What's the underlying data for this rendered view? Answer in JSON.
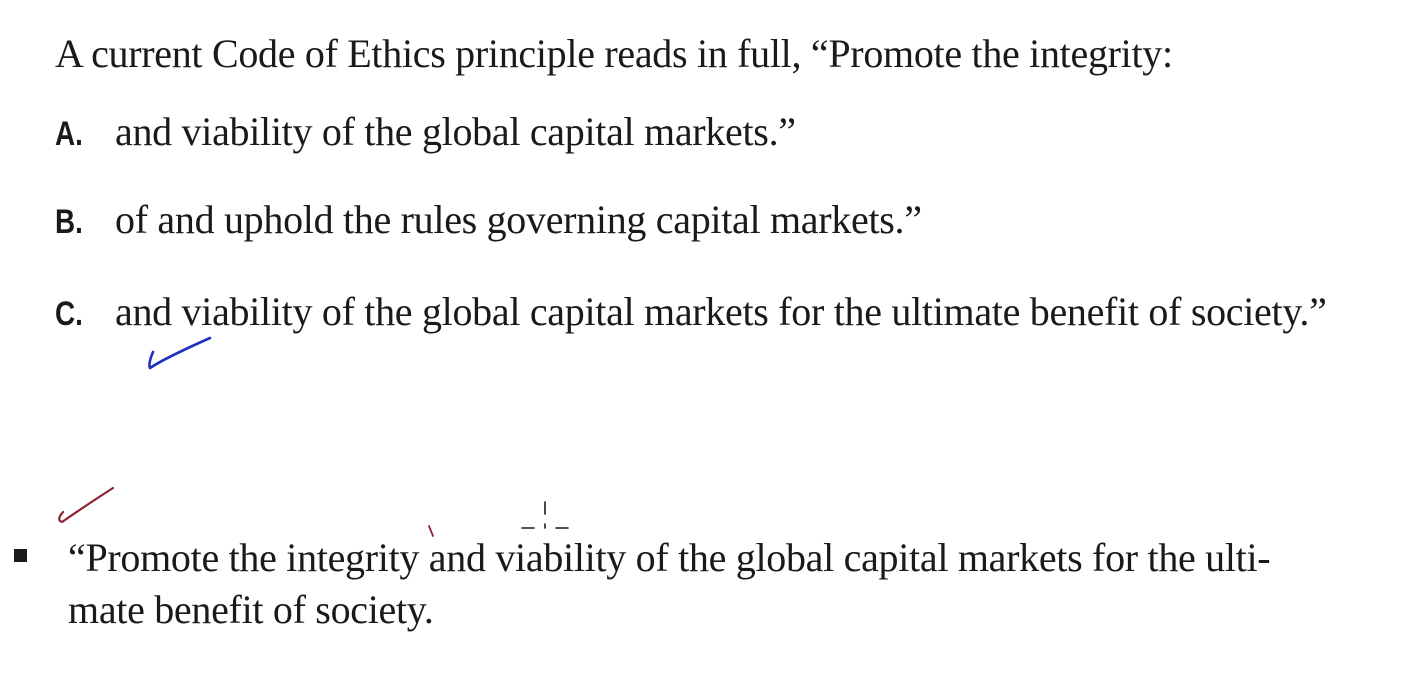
{
  "question": {
    "text": "A current Code of Ethics principle reads in full, “Promote the integrity:"
  },
  "options": [
    {
      "letter": "A.",
      "text": "and viability of the global capital markets.”"
    },
    {
      "letter": "B.",
      "text": "of and uphold the rules governing capital markets.”"
    },
    {
      "letter": "C.",
      "text": "and viability of the global capital markets for the ultimate benefit of society.”"
    }
  ],
  "explanation": {
    "line1": "“Promote the integrity and viability of the global capital markets for the ulti-",
    "line2": "mate benefit of society."
  },
  "annotations": {
    "blue_ink": "#1f2fbf",
    "red_ink": "#8b2332",
    "icons": [
      "checkmark-icon",
      "checkmark-icon",
      "cursor-crosshair-icon"
    ]
  }
}
